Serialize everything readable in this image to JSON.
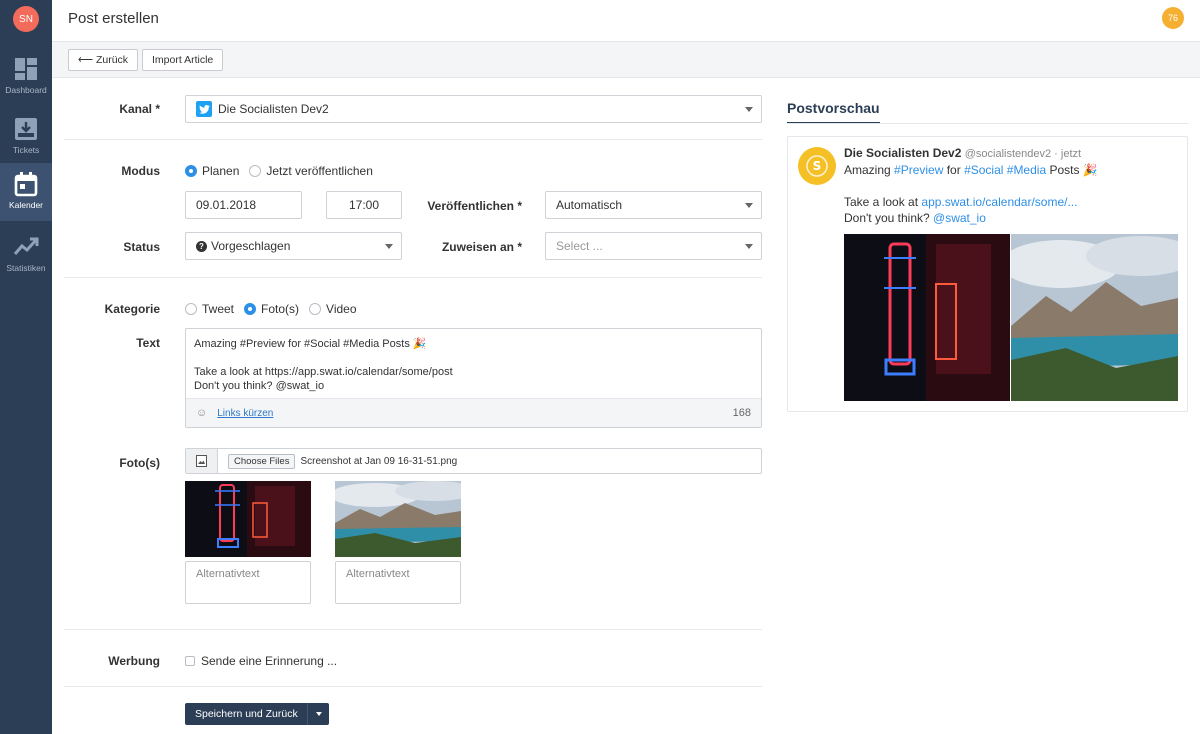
{
  "sidebar": {
    "avatar_initials": "SN",
    "items": [
      {
        "label": "Dashboard",
        "icon": "dashboard-icon"
      },
      {
        "label": "Tickets",
        "icon": "inbox-icon"
      },
      {
        "label": "Kalender",
        "icon": "calendar-icon"
      },
      {
        "label": "Statistiken",
        "icon": "trend-chart-icon"
      }
    ]
  },
  "header": {
    "title": "Post erstellen",
    "badge": "76"
  },
  "toolbar": {
    "back_label": "⟵ Zurück",
    "import_label": "Import Article"
  },
  "form": {
    "kanal": {
      "label": "Kanal *",
      "value": "Die Socialisten Dev2"
    },
    "modus": {
      "label": "Modus",
      "options": [
        "Planen",
        "Jetzt veröffentlichen"
      ],
      "selected": "Planen"
    },
    "date": "09.01.2018",
    "time": "17:00",
    "veroeffentlichen": {
      "label": "Veröffentlichen *",
      "value": "Automatisch"
    },
    "status": {
      "label": "Status",
      "value": "Vorgeschlagen"
    },
    "zuweisen": {
      "label": "Zuweisen an *",
      "placeholder": "Select ..."
    },
    "kategorie": {
      "label": "Kategorie",
      "options": [
        "Tweet",
        "Foto(s)",
        "Video"
      ],
      "selected": "Foto(s)"
    },
    "text": {
      "label": "Text",
      "line1": "Amazing #Preview for #Social #Media Posts 🎉",
      "line2": "Take a look at https://app.swat.io/calendar/some/post",
      "line3": "Don't you think? @swat_io",
      "links_kuerzen": "Links kürzen",
      "char_count": "168"
    },
    "fotos": {
      "label": "Foto(s)",
      "choose_label": "Choose Files",
      "file_name": "Screenshot at Jan 09 16-31-51.png",
      "alt_placeholder": "Alternativtext"
    },
    "werbung": {
      "label": "Werbung",
      "checkbox_label": "Sende eine Erinnerung ..."
    },
    "save_label": "Speichern und Zurück"
  },
  "preview": {
    "tab_label": "Postvorschau",
    "name": "Die Socialisten Dev2",
    "handle": "@socialistendev2 · jetzt",
    "t1_a": "Amazing ",
    "t1_b": "#Preview",
    "t1_c": " for ",
    "t1_d": "#Social",
    "t1_e": " ",
    "t1_f": "#Media",
    "t1_g": " Posts 🎉",
    "t2_a": "Take a look at ",
    "t2_b": "app.swat.io/calendar/some/...",
    "t3_a": "Don't you think? ",
    "t3_b": "@swat_io"
  },
  "colors": {
    "sidebar": "#2c3e55",
    "accent": "#2d8fe6",
    "badge": "#f5b031",
    "avatar": "#f26b5b"
  }
}
